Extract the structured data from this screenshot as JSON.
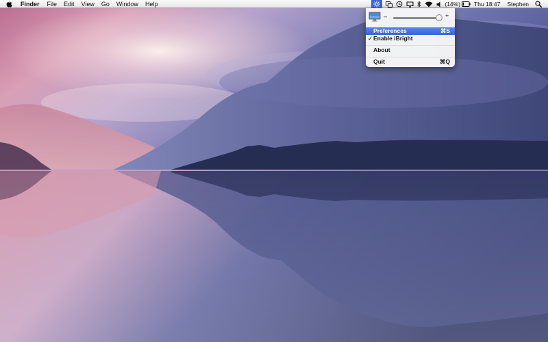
{
  "menubar": {
    "apple_icon": "apple-logo-icon",
    "menus": [
      "Finder",
      "File",
      "Edit",
      "View",
      "Go",
      "Window",
      "Help"
    ],
    "status_icons": [
      "ibright-sun-icon",
      "spaces-icon",
      "time-machine-icon",
      "display-mirroring-icon",
      "bluetooth-icon",
      "wifi-icon",
      "volume-icon",
      "battery-icon"
    ],
    "battery_text": "(14%)",
    "clock": "Thu 18:47",
    "user": "Stephen",
    "spotlight_icon": "spotlight-search-icon",
    "active_color": "#3a64d8"
  },
  "dropdown": {
    "brightness": {
      "minus": "–",
      "plus": "+",
      "level": 0.93,
      "icon": "display-icon"
    },
    "items": [
      {
        "label": "Preferences",
        "shortcut": "⌘S",
        "highlighted": true
      },
      {
        "label": "Enable iBright",
        "checked": true,
        "check": "✓"
      },
      {
        "label": "About"
      },
      {
        "label": "Quit",
        "shortcut": "⌘Q"
      }
    ],
    "highlight_color": "#3563dc"
  }
}
